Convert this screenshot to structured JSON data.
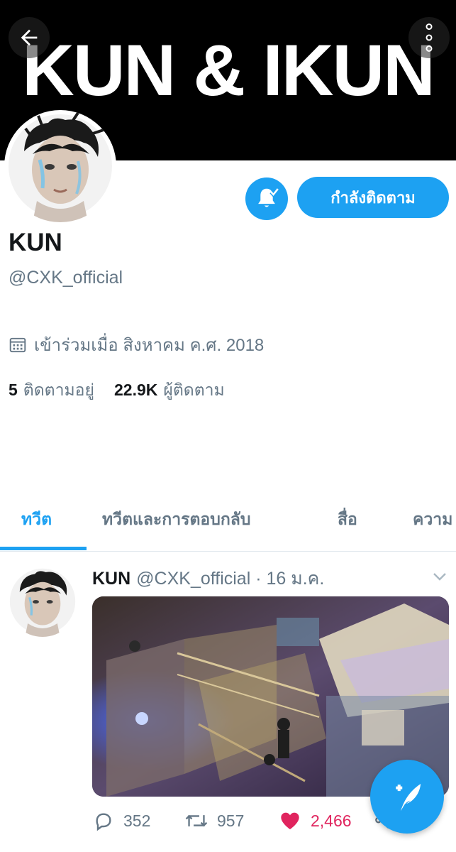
{
  "banner": {
    "text": "KUN & IKUN"
  },
  "header": {
    "back_icon": "arrow-left-icon",
    "more_icon": "more-vertical-icon"
  },
  "profile": {
    "name": "KUN",
    "handle": "@CXK_official",
    "joined": "เข้าร่วมเมื่อ สิงหาคม ค.ศ. 2018",
    "following_count": "5",
    "following_label": "ติดตามอยู่",
    "followers_count": "22.9K",
    "followers_label": "ผู้ติดตาม",
    "follow_button_label": "กำลังติดตาม",
    "bell_icon": "notification-bell-icon"
  },
  "tabs": [
    {
      "label": "ทวีต",
      "active": true
    },
    {
      "label": "ทวีตและการตอบกลับ",
      "active": false
    },
    {
      "label": "สื่อ",
      "active": false
    },
    {
      "label": "ความ",
      "active": false
    }
  ],
  "tweet": {
    "name": "KUN",
    "handle": "@CXK_official",
    "date": "· 16 ม.ค.",
    "replies": "352",
    "retweets": "957",
    "likes": "2,466",
    "liked": true
  },
  "colors": {
    "accent": "#1da1f2",
    "like": "#e0245e",
    "muted": "#657786",
    "text": "#14171a"
  }
}
